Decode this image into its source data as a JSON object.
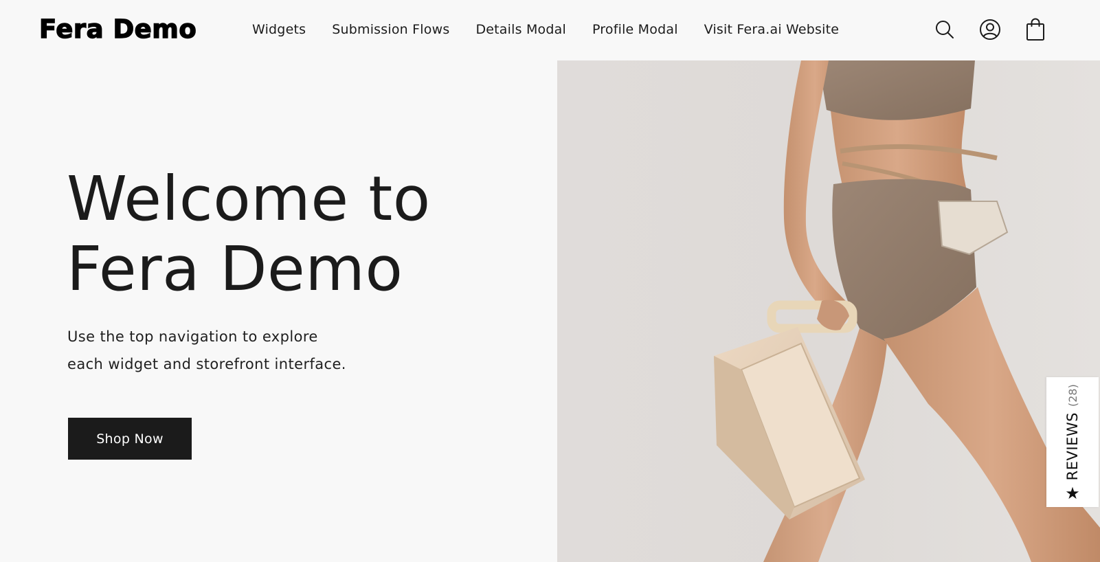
{
  "header": {
    "logo": "Fera Demo",
    "nav": [
      {
        "label": "Widgets"
      },
      {
        "label": "Submission Flows"
      },
      {
        "label": "Details Modal"
      },
      {
        "label": "Profile Modal"
      },
      {
        "label": "Visit Fera.ai Website"
      }
    ],
    "icons": [
      "search-icon",
      "account-icon",
      "cart-icon"
    ]
  },
  "hero": {
    "title_line1": "Welcome to",
    "title_line2": "Fera Demo",
    "subtitle_line1": "Use the top navigation to explore",
    "subtitle_line2": "each widget and storefront interface.",
    "button_label": "Shop Now",
    "image": "model-with-beige-handbag-photo"
  },
  "reviews_tab": {
    "label": "REVIEWS",
    "count": "(28)",
    "icon": "star-icon"
  },
  "colors": {
    "background": "#f8f8f8",
    "text": "#1b1b1b",
    "button_bg": "#1b1b1b",
    "button_text": "#ffffff",
    "tab_bg": "#ffffff"
  }
}
